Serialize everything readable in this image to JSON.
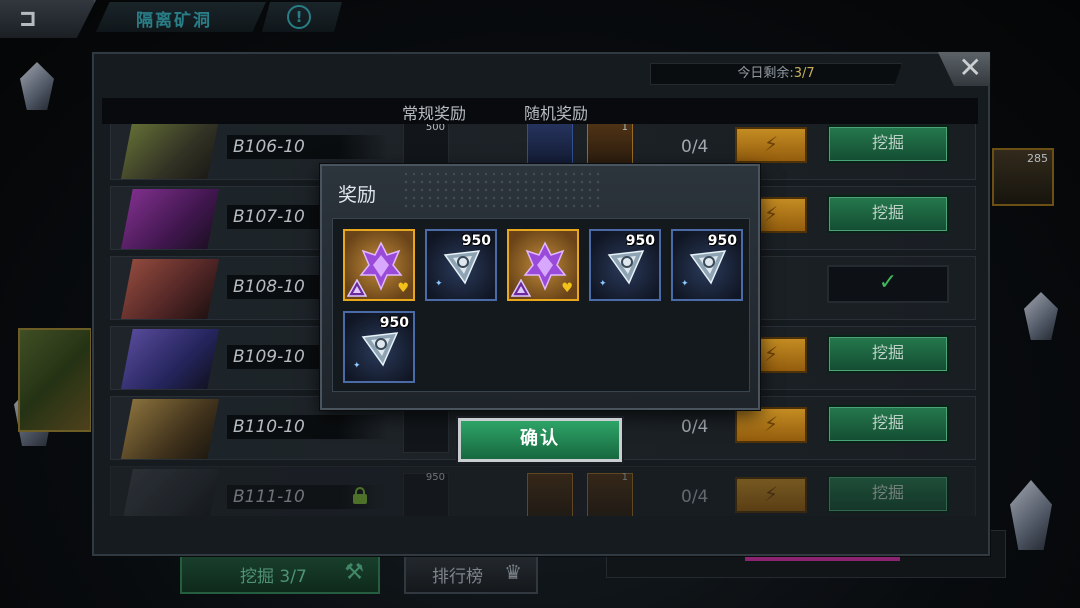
{
  "topbar": {
    "title": "隔离矿洞",
    "info_glyph": "!"
  },
  "window": {
    "remaining_label": "今日剩余:",
    "remaining_value": "3/7",
    "close_glyph": "✕"
  },
  "columns": {
    "regular": "常规奖励",
    "random": "随机奖励"
  },
  "rows": [
    {
      "name": "B106-10",
      "progress": "0/4",
      "action": "挖掘",
      "status": "available"
    },
    {
      "name": "B107-10",
      "progress": "",
      "action": "挖掘",
      "status": "available"
    },
    {
      "name": "B108-10",
      "progress": "",
      "action": "✓",
      "status": "done"
    },
    {
      "name": "B109-10",
      "progress": "",
      "action": "挖掘",
      "status": "available"
    },
    {
      "name": "B110-10",
      "progress": "0/4",
      "action": "挖掘",
      "status": "available"
    },
    {
      "name": "B111-10",
      "progress": "0/4",
      "action": "挖掘",
      "status": "locked"
    }
  ],
  "row_slot_labels": {
    "r106_regular": "500",
    "r111_regular": "950",
    "r106_random": "1",
    "r111_random": "1"
  },
  "right_card": {
    "value": "285"
  },
  "bottom": {
    "dig_tab": "挖掘 3/7",
    "rank_tab": "排行榜"
  },
  "popup": {
    "title": "奖励",
    "items": [
      {
        "type": "purple-gem",
        "qty": ""
      },
      {
        "type": "prism-shard",
        "qty": "950"
      },
      {
        "type": "purple-gem",
        "qty": ""
      },
      {
        "type": "prism-shard",
        "qty": "950"
      },
      {
        "type": "prism-shard",
        "qty": "950"
      },
      {
        "type": "prism-shard",
        "qty": "950"
      }
    ],
    "confirm": "确认"
  },
  "colors": {
    "accent_green": "#2ea468",
    "gold": "#e8a81e",
    "teal_title": "#2f8f9a"
  }
}
